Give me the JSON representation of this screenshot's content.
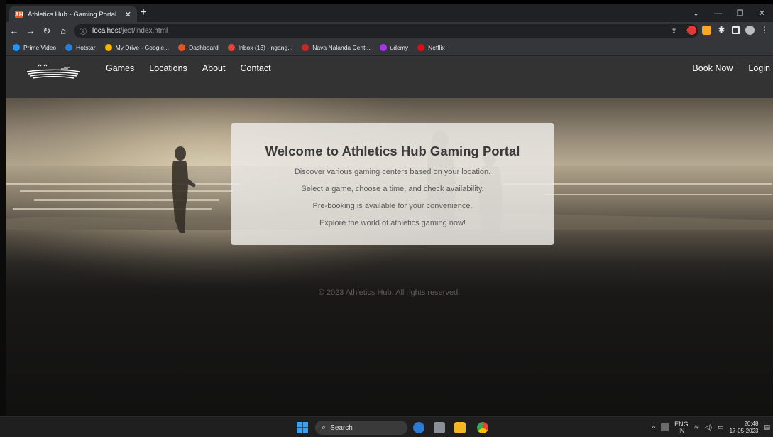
{
  "browser": {
    "tab_title": "Athletics Hub - Gaming Portal",
    "tab_favicon": "AH",
    "url_host": "localhost",
    "url_path": "/ject/index.html",
    "bookmarks": [
      {
        "label": "Prime Video",
        "color": "#1a98ff"
      },
      {
        "label": "Hotstar",
        "color": "#1f80e0"
      },
      {
        "label": "My Drive - Google...",
        "color": "#f4b400"
      },
      {
        "label": "Dashboard",
        "color": "#e8541f"
      },
      {
        "label": "Inbox (13) - ngang...",
        "color": "#ea4335"
      },
      {
        "label": "Nava Nalanda Cent...",
        "color": "#c62828"
      },
      {
        "label": "udemy",
        "color": "#a435f0"
      },
      {
        "label": "Netflix",
        "color": "#e50914"
      }
    ]
  },
  "site": {
    "nav": {
      "links": [
        "Games",
        "Locations",
        "About",
        "Contact"
      ],
      "book_now": "Book Now",
      "login": "Login"
    },
    "welcome": {
      "title": "Welcome to Athletics Hub Gaming Portal",
      "lines": [
        "Discover various gaming centers based on your location.",
        "Select a game, choose a time, and check availability.",
        "Pre-booking is available for your convenience.",
        "Explore the world of athletics gaming now!"
      ]
    },
    "footer": "© 2023 Athletics Hub. All rights reserved."
  },
  "taskbar": {
    "search_label": "Search",
    "lang_line1": "ENG",
    "lang_line2": "IN",
    "time": "20:48",
    "date": "17-05-2023"
  }
}
